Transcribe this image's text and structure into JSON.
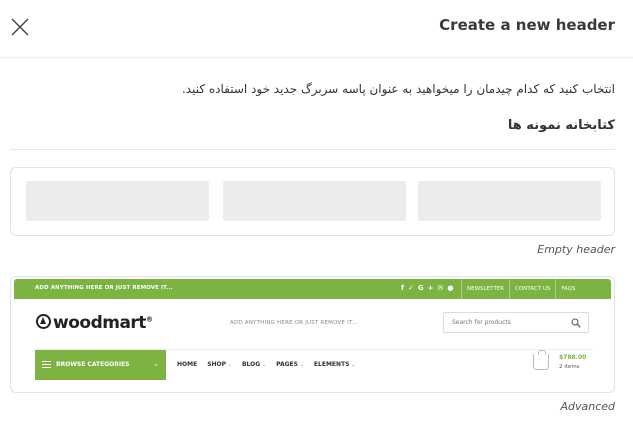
{
  "header": {
    "title": "Create a new header",
    "close_icon": "close-icon"
  },
  "intro": {
    "description": "انتخاب کنید که کدام چیدمان را میخواهید به عنوان پاسه سربرگ جدید خود استفاده کنید.",
    "library_title": "کتابخانه نمونه ها"
  },
  "templates": [
    {
      "caption": "Empty header"
    },
    {
      "caption": "Advanced",
      "preview": {
        "accent_color": "#7cb342",
        "topbar_promo": "ADD ANYTHING HERE OR JUST REMOVE IT...",
        "social_icons": [
          "facebook-icon",
          "twitter-icon",
          "google-plus-icon",
          "email-icon",
          "pinterest-icon"
        ],
        "topbar_links": [
          "NEWSLETTER",
          "CONTACT US",
          "FAQS"
        ],
        "logo_text": "woodmart",
        "logo_mark": "®",
        "middle_promo": "ADD ANYTHING HERE OR JUST REMOVE IT...",
        "search_placeholder": "Search for products",
        "browse_label": "BROWSE CATEGORIES",
        "menu": [
          {
            "label": "HOME"
          },
          {
            "label": "SHOP"
          },
          {
            "label": "BLOG"
          },
          {
            "label": "PAGES"
          },
          {
            "label": "ELEMENTS"
          }
        ],
        "cart_price": "$788.00",
        "cart_items": "2 items"
      }
    }
  ]
}
